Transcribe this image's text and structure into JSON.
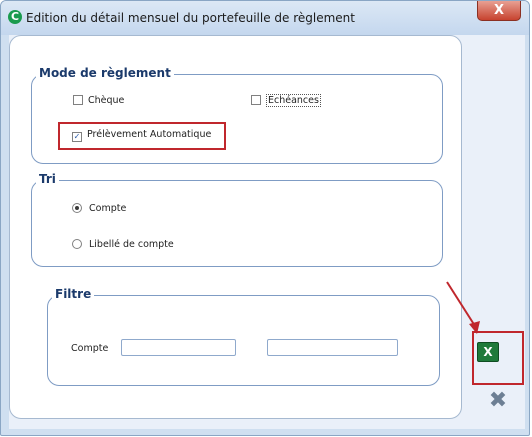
{
  "window": {
    "title": "Edition du détail mensuel du portefeuille de règlement",
    "app_icon_glyph": "C",
    "close_glyph": "X"
  },
  "mode_reglement": {
    "title": "Mode de règlement",
    "options": [
      {
        "label": "Chèque",
        "checked": false
      },
      {
        "label": "Echéances",
        "checked": false
      },
      {
        "label": "Prélèvement Automatique",
        "checked": true
      }
    ]
  },
  "tri": {
    "title": "Tri",
    "options": [
      {
        "label": "Compte",
        "selected": true
      },
      {
        "label": "Libellé de compte",
        "selected": false
      }
    ]
  },
  "filtre": {
    "title": "Filtre",
    "compte_label": "Compte",
    "compte_from": "",
    "compte_to": ""
  },
  "actions": {
    "excel_icon": "excel-export-icon",
    "excel_glyph": "X",
    "close_icon": "close-x-icon",
    "close_glyph": "✖"
  },
  "colors": {
    "annotation_red": "#c0272d",
    "group_border": "#7f9cc4",
    "excel_green": "#1f7a3a"
  }
}
